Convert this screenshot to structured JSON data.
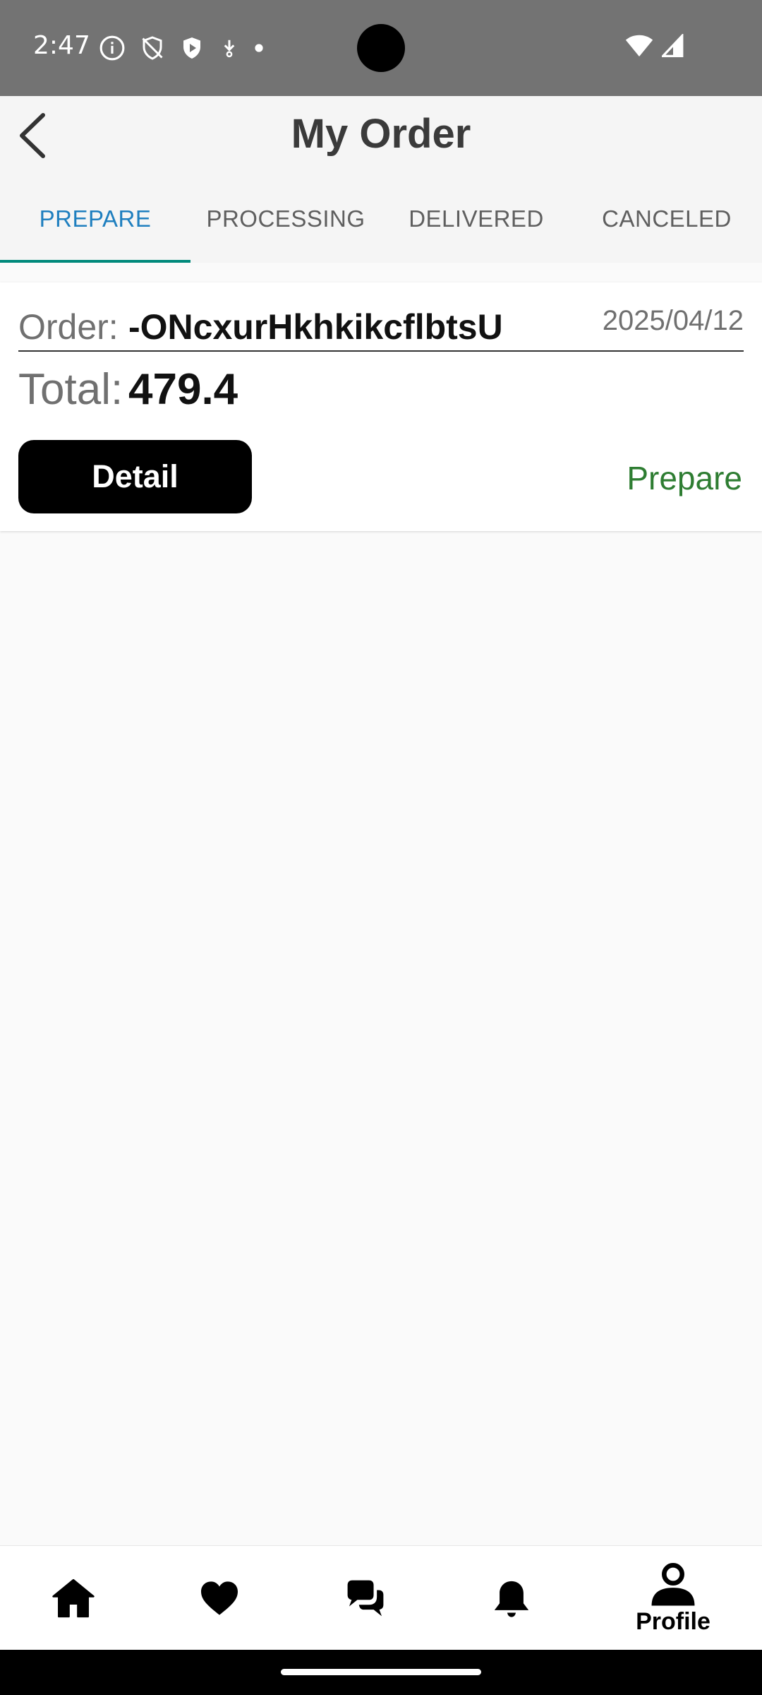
{
  "status_bar": {
    "time": "2:47"
  },
  "header": {
    "title": "My Order"
  },
  "tabs": [
    {
      "label": "PREPARE",
      "active": true
    },
    {
      "label": "PROCESSING",
      "active": false
    },
    {
      "label": "DELIVERED",
      "active": false
    },
    {
      "label": "CANCELED",
      "active": false
    }
  ],
  "order": {
    "order_label": "Order:",
    "order_id": "-ONcxurHkhkikcflbtsU",
    "date": "2025/04/12",
    "total_label": "Total:",
    "total_value": "479.4",
    "detail_label": "Detail",
    "status": "Prepare"
  },
  "bottom_nav": {
    "items": [
      {
        "icon": "home-icon"
      },
      {
        "icon": "heart-icon"
      },
      {
        "icon": "chat-icon"
      },
      {
        "icon": "bell-icon"
      },
      {
        "icon": "profile-icon",
        "label": "Profile"
      }
    ]
  },
  "colors": {
    "active_tab": "#1f7fbf",
    "tab_indicator": "#00897b",
    "status_prepare": "#2e7d32",
    "button_bg": "#000000"
  }
}
